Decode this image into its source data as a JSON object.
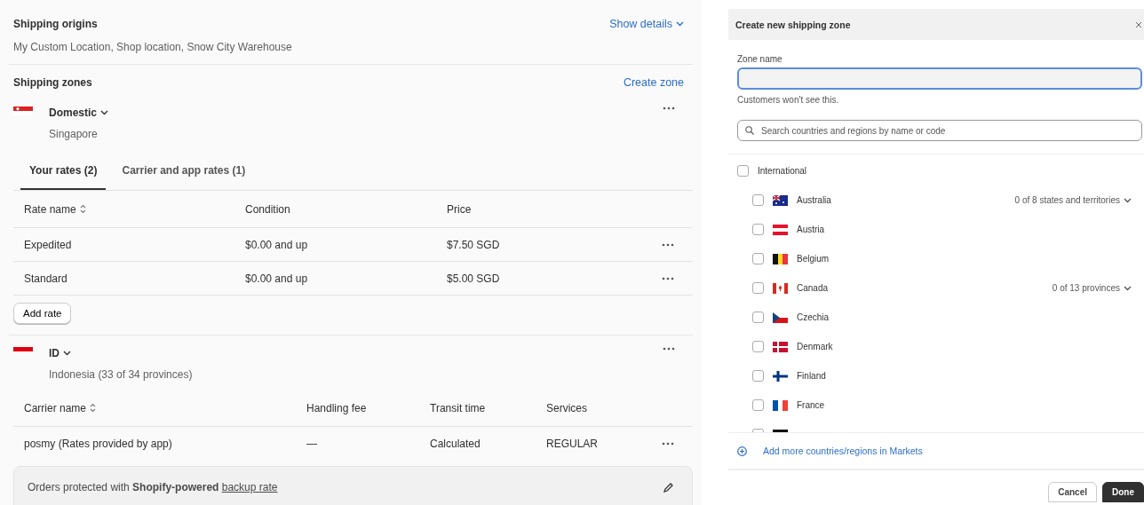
{
  "origins": {
    "title": "Shipping origins",
    "action": "Show details",
    "locations": "My Custom Location, Shop location, Snow City Warehouse"
  },
  "zones_header": {
    "title": "Shipping zones",
    "action": "Create zone"
  },
  "domestic": {
    "kind": "sg",
    "name": "Domestic",
    "region": "Singapore",
    "tabs": [
      {
        "label": "Your rates (2)",
        "selected": true
      },
      {
        "label": "Carrier and app rates (1)",
        "selected": false
      }
    ],
    "columns": [
      "Rate name",
      "Condition",
      "Price"
    ],
    "rows": [
      {
        "name": "Expedited",
        "condition": "$0.00 and up",
        "price": "$7.50 SGD"
      },
      {
        "name": "Standard",
        "condition": "$0.00 and up",
        "price": "$5.00 SGD"
      }
    ],
    "add_button": "Add rate"
  },
  "id_zone": {
    "kind": "id",
    "name": "ID",
    "region": "Indonesia (33 of 34 provinces)",
    "columns": [
      "Carrier name",
      "Handling fee",
      "Transit time",
      "Services"
    ],
    "rows": [
      {
        "name": "posmy (Rates provided by app)",
        "fee": "—",
        "transit": "Calculated",
        "services": "REGULAR"
      }
    ],
    "backup": "Orders protected with **Shopify-powered**",
    "backup_link": "backup rate"
  },
  "dialog": {
    "title": "Create new shipping zone",
    "zone_label": "Zone name",
    "zone_focused": true,
    "help": "Customers won't see this.",
    "search_placeholder": "Search countries and regions by name or code",
    "group": {
      "label": "International",
      "checked": false
    },
    "countries": [
      {
        "kind": "au",
        "name": "Australia",
        "checked": false,
        "subdivisions": "0 of 8 states and territories"
      },
      {
        "kind": "at",
        "name": "Austria",
        "checked": false
      },
      {
        "kind": "be",
        "name": "Belgium",
        "checked": false
      },
      {
        "kind": "ca",
        "name": "Canada",
        "checked": false,
        "subdivisions": "0 of 13 provinces"
      },
      {
        "kind": "cz",
        "name": "Czechia",
        "checked": false
      },
      {
        "kind": "dk",
        "name": "Denmark",
        "checked": false
      },
      {
        "kind": "fi",
        "name": "Finland",
        "checked": false
      },
      {
        "kind": "fr",
        "name": "France",
        "checked": false
      }
    ],
    "cut_row": {
      "kind": "de",
      "checked": false
    },
    "add_more": "Add more countries/regions in Markets",
    "buttons": [
      {
        "label": "Cancel",
        "kind": "secondary"
      },
      {
        "label": "Done",
        "kind": "primary"
      }
    ]
  }
}
